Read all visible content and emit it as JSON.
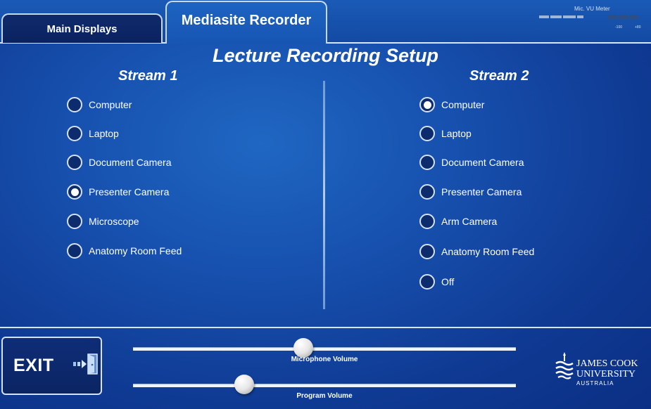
{
  "tabs": {
    "main_displays": "Main Displays",
    "mediasite_recorder": "Mediasite Recorder"
  },
  "vu_meter": {
    "label": "Mic. VU Meter",
    "tick_low": "-100",
    "tick_high": "+80"
  },
  "page_title": "Lecture Recording Setup",
  "stream1": {
    "title": "Stream 1",
    "options": [
      {
        "label": "Computer",
        "selected": false
      },
      {
        "label": "Laptop",
        "selected": false
      },
      {
        "label": "Document Camera",
        "selected": false
      },
      {
        "label": "Presenter Camera",
        "selected": true
      },
      {
        "label": "Microscope",
        "selected": false
      },
      {
        "label": "Anatomy Room Feed",
        "selected": false
      }
    ]
  },
  "stream2": {
    "title": "Stream 2",
    "options": [
      {
        "label": "Computer",
        "selected": true
      },
      {
        "label": "Laptop",
        "selected": false
      },
      {
        "label": "Document Camera",
        "selected": false
      },
      {
        "label": "Presenter Camera",
        "selected": false
      },
      {
        "label": "Arm Camera",
        "selected": false
      },
      {
        "label": "Anatomy Room Feed",
        "selected": false
      },
      {
        "label": "Off",
        "selected": false
      }
    ]
  },
  "exit": {
    "label": "EXIT",
    "icon": "exit-door-icon"
  },
  "sliders": {
    "microphone": {
      "label": "Microphone Volume",
      "level_fraction": 0.445
    },
    "program": {
      "label": "Program Volume",
      "level_fraction": 0.29
    }
  },
  "logo": {
    "line1": "JAMES COOK",
    "line2": "UNIVERSITY",
    "line3": "AUSTRALIA"
  },
  "colors": {
    "background": "#1750ae",
    "panel_dark": "#0b2562",
    "accent_light": "#d7e6f7"
  }
}
